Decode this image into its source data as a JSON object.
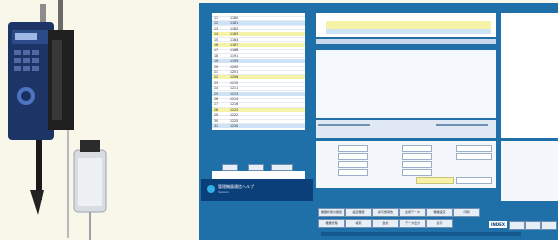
{
  "left_table": {
    "rows": [
      {
        "num": "11",
        "code": "1180"
      },
      {
        "num": "12",
        "code": "1181"
      },
      {
        "num": "13",
        "code": "1182"
      },
      {
        "num": "14",
        "code": "1183"
      },
      {
        "num": "15",
        "code": "1184"
      },
      {
        "num": "16",
        "code": "1187"
      },
      {
        "num": "17",
        "code": "1188"
      },
      {
        "num": "18",
        "code": "1191"
      },
      {
        "num": "19",
        "code": "1195"
      },
      {
        "num": "20",
        "code": "1200"
      },
      {
        "num": "21",
        "code": "1201"
      },
      {
        "num": "22",
        "code": "1206"
      },
      {
        "num": "23",
        "code": "1210"
      },
      {
        "num": "24",
        "code": "1211"
      },
      {
        "num": "25",
        "code": "1213"
      },
      {
        "num": "26",
        "code": "1214"
      },
      {
        "num": "27",
        "code": "1216"
      },
      {
        "num": "28",
        "code": "1220"
      },
      {
        "num": "29",
        "code": "1222"
      },
      {
        "num": "30",
        "code": "1225"
      },
      {
        "num": "31",
        "code": "1230"
      }
    ]
  },
  "bottom_logo_text": "管理機器通信ヘルプ",
  "bottom_logo_subtext": "Version",
  "menu_buttons_row1": [
    "機器状態の確認",
    "設定履歴",
    "投与量報告",
    "患者データ",
    "機器設定",
    "印刷"
  ],
  "menu_buttons_row2": [
    "機器管理",
    "検索",
    "集計",
    "データ出力",
    "表示"
  ],
  "index_button": "INDEX",
  "colors": {
    "app_bg": "#1f6fa8",
    "panel_bg": "#ffffff",
    "row_highlight_yellow": "#f6f3a8",
    "row_highlight_blue": "#cfe3f6",
    "device_body": "#1d3566"
  }
}
